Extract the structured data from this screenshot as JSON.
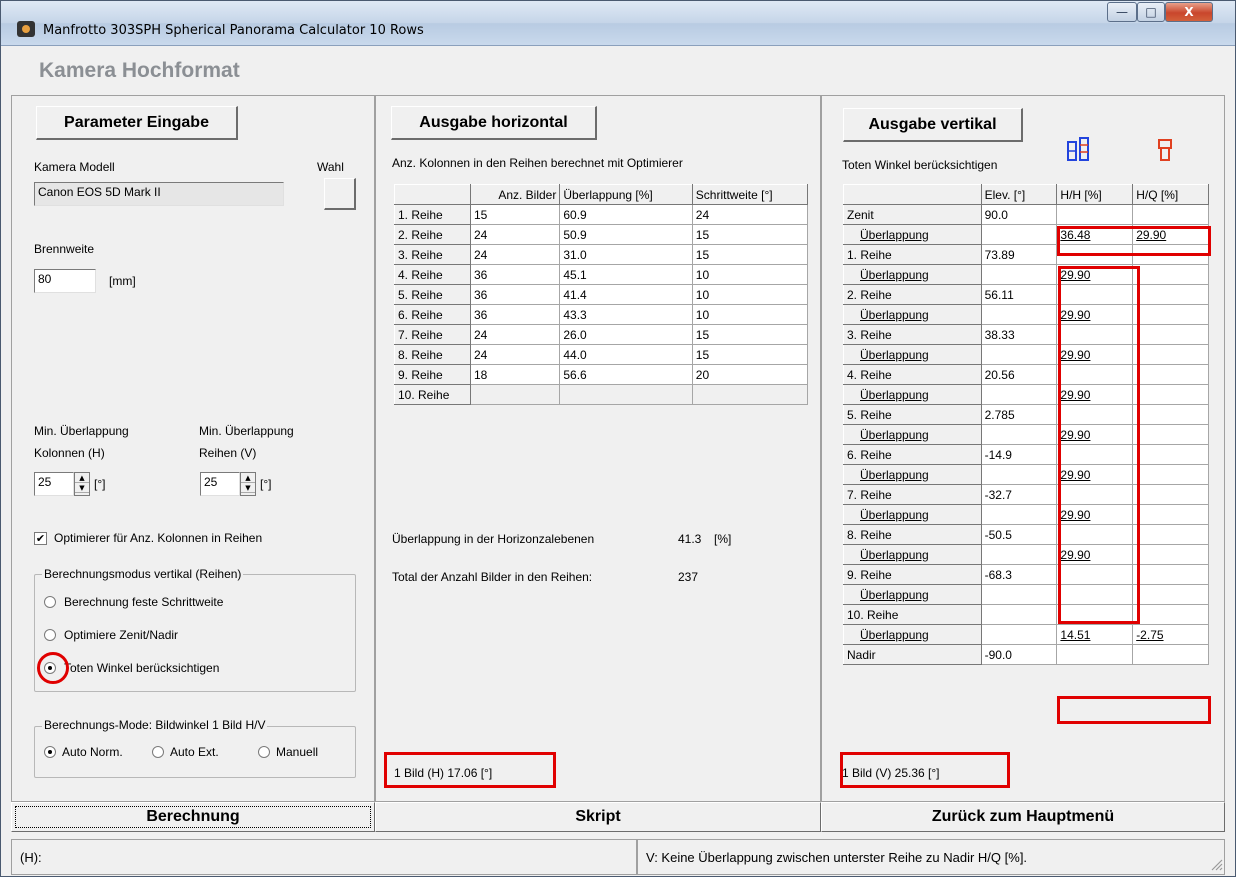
{
  "window": {
    "title": "Manfrotto 303SPH  Spherical  Panorama Calculator 10 Rows",
    "minimize": "—",
    "maximize": "□",
    "close": "X"
  },
  "header": {
    "title": "Kamera Hochformat"
  },
  "left": {
    "param_button": "Parameter Eingabe",
    "camera_label": "Kamera Modell",
    "wahl_label": "Wahl",
    "camera_value": "Canon EOS 5D Mark II",
    "focal_label": "Brennweite",
    "focal_value": "80",
    "focal_unit": "[mm]",
    "overlap_h_label1": "Min. Überlappung",
    "overlap_h_label2": "Kolonnen (H)",
    "overlap_h_value": "25",
    "overlap_h_unit": "[°]",
    "overlap_v_label1": "Min. Überlappung",
    "overlap_v_label2": "Reihen (V)",
    "overlap_v_value": "25",
    "overlap_v_unit": "[°]",
    "optimizer_label": "Optimierer für Anz. Kolonnen in Reihen",
    "optimizer_checked": "✔",
    "mode_group": "Berechnungsmodus vertikal (Reihen)",
    "mode_options": [
      "Berechnung feste Schrittweite",
      "Optimiere Zenit/Nadir",
      "Toten Winkel berücksichtigen"
    ],
    "angle_group": "Berechnungs-Mode: Bildwinkel 1 Bild H/V",
    "angle_options": [
      "Auto Norm.",
      "Auto Ext.",
      "Manuell"
    ]
  },
  "middle": {
    "button": "Ausgabe horizontal",
    "desc": "Anz. Kolonnen in den Reihen berechnet mit Optimierer",
    "headers": [
      "Anz. Bilder",
      "Überlappung [%]",
      "Schrittweite [°]"
    ],
    "rows": [
      {
        "label": "1. Reihe",
        "count": "15",
        "overlap": "60.9",
        "step": "24"
      },
      {
        "label": "2. Reihe",
        "count": "24",
        "overlap": "50.9",
        "step": "15"
      },
      {
        "label": "3. Reihe",
        "count": "24",
        "overlap": "31.0",
        "step": "15"
      },
      {
        "label": "4. Reihe",
        "count": "36",
        "overlap": "45.1",
        "step": "10"
      },
      {
        "label": "5. Reihe",
        "count": "36",
        "overlap": "41.4",
        "step": "10"
      },
      {
        "label": "6. Reihe",
        "count": "36",
        "overlap": "43.3",
        "step": "10"
      },
      {
        "label": "7. Reihe",
        "count": "24",
        "overlap": "26.0",
        "step": "15"
      },
      {
        "label": "8. Reihe",
        "count": "24",
        "overlap": "44.0",
        "step": "15"
      },
      {
        "label": "9. Reihe",
        "count": "18",
        "overlap": "56.6",
        "step": "20"
      },
      {
        "label": "10. Reihe",
        "count": "",
        "overlap": "",
        "step": ""
      }
    ],
    "horizon_label": "Überlappung in der Horizonzalebenen",
    "horizon_value": "41.3",
    "horizon_unit": "[%]",
    "total_label": "Total der Anzahl Bilder in den Reihen:",
    "total_value": "237",
    "one_image": "1 Bild (H)   17.06  [°]"
  },
  "right": {
    "button": "Ausgabe vertikal",
    "desc": "Toten Winkel berücksichtigen",
    "headers": [
      "Elev. [°]",
      "H/H [%]",
      "H/Q [%]"
    ],
    "rows": [
      {
        "label": "Zenit",
        "elev": "90.0",
        "hh": "",
        "hq": "",
        "indent": false
      },
      {
        "label": "Überlappung",
        "elev": "",
        "hh": "36.48",
        "hq": "29.90",
        "indent": true
      },
      {
        "label": "1. Reihe",
        "elev": "73.89",
        "hh": "",
        "hq": "",
        "indent": false
      },
      {
        "label": "Überlappung",
        "elev": "",
        "hh": "29.90",
        "hq": "",
        "indent": true
      },
      {
        "label": "2. Reihe",
        "elev": "56.11",
        "hh": "",
        "hq": "",
        "indent": false
      },
      {
        "label": "Überlappung",
        "elev": "",
        "hh": "29.90",
        "hq": "",
        "indent": true
      },
      {
        "label": "3. Reihe",
        "elev": "38.33",
        "hh": "",
        "hq": "",
        "indent": false
      },
      {
        "label": "Überlappung",
        "elev": "",
        "hh": "29.90",
        "hq": "",
        "indent": true
      },
      {
        "label": "4. Reihe",
        "elev": "20.56",
        "hh": "",
        "hq": "",
        "indent": false
      },
      {
        "label": "Überlappung",
        "elev": "",
        "hh": "29.90",
        "hq": "",
        "indent": true
      },
      {
        "label": "5. Reihe",
        "elev": "2.785",
        "hh": "",
        "hq": "",
        "indent": false
      },
      {
        "label": "Überlappung",
        "elev": "",
        "hh": "29.90",
        "hq": "",
        "indent": true
      },
      {
        "label": "6. Reihe",
        "elev": "-14.9",
        "hh": "",
        "hq": "",
        "indent": false
      },
      {
        "label": "Überlappung",
        "elev": "",
        "hh": "29.90",
        "hq": "",
        "indent": true
      },
      {
        "label": "7. Reihe",
        "elev": "-32.7",
        "hh": "",
        "hq": "",
        "indent": false
      },
      {
        "label": "Überlappung",
        "elev": "",
        "hh": "29.90",
        "hq": "",
        "indent": true
      },
      {
        "label": "8. Reihe",
        "elev": "-50.5",
        "hh": "",
        "hq": "",
        "indent": false
      },
      {
        "label": "Überlappung",
        "elev": "",
        "hh": "29.90",
        "hq": "",
        "indent": true
      },
      {
        "label": "9. Reihe",
        "elev": "-68.3",
        "hh": "",
        "hq": "",
        "indent": false
      },
      {
        "label": "Überlappung",
        "elev": "",
        "hh": "",
        "hq": "",
        "indent": true
      },
      {
        "label": "10. Reihe",
        "elev": "",
        "hh": "",
        "hq": "",
        "indent": false
      },
      {
        "label": "Überlappung",
        "elev": "",
        "hh": "14.51",
        "hq": "-2.75",
        "indent": true
      },
      {
        "label": "Nadir",
        "elev": "-90.0",
        "hh": "",
        "hq": "",
        "indent": false
      }
    ],
    "one_image": "1 Bild (V)   25.36  [°]"
  },
  "bottom": {
    "calc": "Berechnung",
    "script": "Skript",
    "back": "Zurück zum Hauptmenü"
  },
  "status": {
    "left": "(H):",
    "right": "V: Keine Überlappung zwischen unterster Reihe zu Nadir H/Q [%]."
  },
  "colors": {
    "highlight": "#e00000",
    "icon_blue": "#2244dd",
    "icon_red": "#e04020"
  }
}
